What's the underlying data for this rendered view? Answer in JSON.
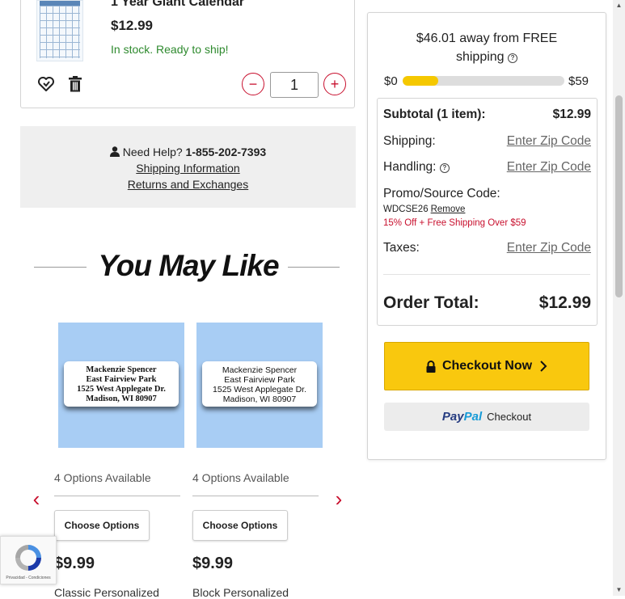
{
  "cart_item": {
    "title": "1 Year Giant Calendar",
    "price": "$12.99",
    "stock": "In stock. Ready to ship!",
    "quantity": "1",
    "minus": "−",
    "plus": "+"
  },
  "help": {
    "prefix": "Need Help?",
    "phone": "1-855-202-7393",
    "shipping_link": "Shipping Information",
    "returns_link": "Returns and Exchanges"
  },
  "recommendations": {
    "heading": "You May Like",
    "products": [
      {
        "label_lines": [
          "Mackenzie Spencer",
          "East Fairview Park",
          "1525 West Applegate Dr.",
          "Madison, WI 80907"
        ],
        "options": "4 Options Available",
        "button": "Choose Options",
        "price": "$9.99",
        "name": "Classic Personalized"
      },
      {
        "label_lines": [
          "Mackenzie Spencer",
          "East Fairview Park",
          "1525 West Applegate Dr.",
          "Madison, WI 80907"
        ],
        "options": "4 Options Available",
        "button": "Choose Options",
        "price": "$9.99",
        "name": "Block Personalized"
      }
    ]
  },
  "recaptcha": {
    "text": "Privacidad - Condiciones"
  },
  "summary": {
    "free_shipping_line1": "$46.01 away from FREE",
    "free_shipping_line2": "shipping",
    "progress_min": "$0",
    "progress_max": "$59",
    "progress_fraction": 0.22,
    "subtotal_label": "Subtotal (1 item):",
    "subtotal_value": "$12.99",
    "shipping_label": "Shipping:",
    "shipping_value": "Enter Zip Code",
    "handling_label": "Handling:",
    "handling_value": "Enter Zip Code",
    "promo_label": "Promo/Source Code:",
    "promo_code": "WDCSE26",
    "promo_remove": "Remove",
    "promo_message": "15% Off + Free Shipping Over $59",
    "taxes_label": "Taxes:",
    "taxes_value": "Enter Zip Code",
    "order_total_label": "Order Total:",
    "order_total_value": "$12.99",
    "checkout_button": "Checkout Now",
    "paypal_pay": "Pay",
    "paypal_pal": "Pal",
    "paypal_checkout": "Checkout"
  },
  "colors": {
    "accent_red": "#c8102e",
    "checkout_yellow": "#f9c80e",
    "stock_green": "#2e8a2e",
    "product_bg": "#a8cdf4"
  }
}
